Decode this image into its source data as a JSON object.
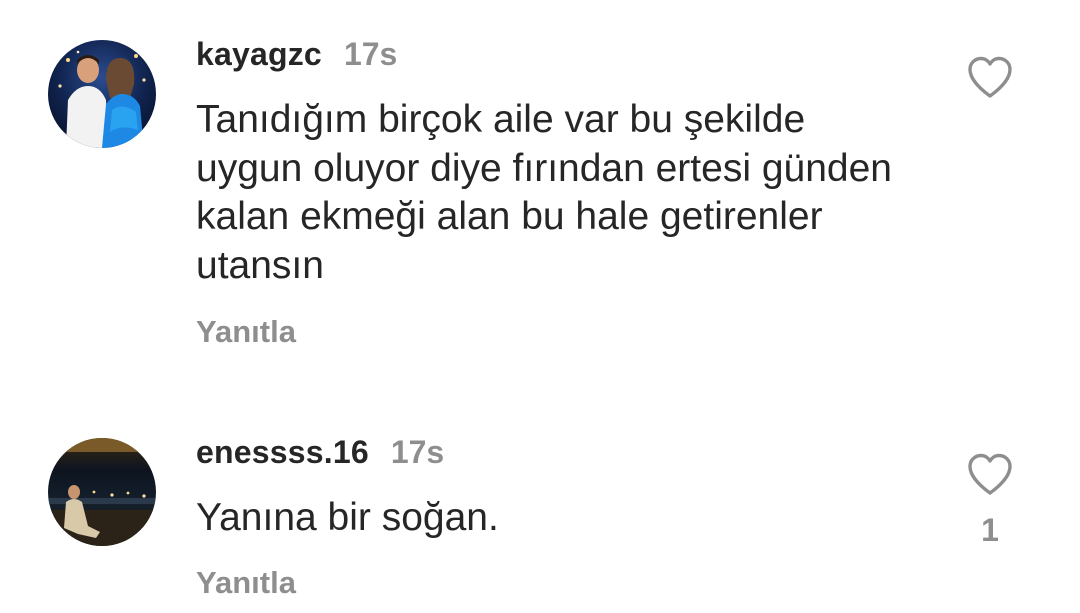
{
  "comments": [
    {
      "username": "kayagzc",
      "time": "17s",
      "text": "Tanıdığım birçok aile var bu şekilde uygun oluyor diye fırından ertesi günden kalan ekmeği alan bu hale getirenler utansın",
      "reply_label": "Yanıtla",
      "like_count": "",
      "icons": {
        "like": "heart-outline-icon"
      }
    },
    {
      "username": "enessss.16",
      "time": "17s",
      "text": "Yanına bir soğan.",
      "reply_label": "Yanıtla",
      "like_count": "1",
      "icons": {
        "like": "heart-outline-icon"
      }
    }
  ],
  "colors": {
    "text_primary": "#262626",
    "text_secondary": "#8e8e8e",
    "background": "#ffffff"
  }
}
